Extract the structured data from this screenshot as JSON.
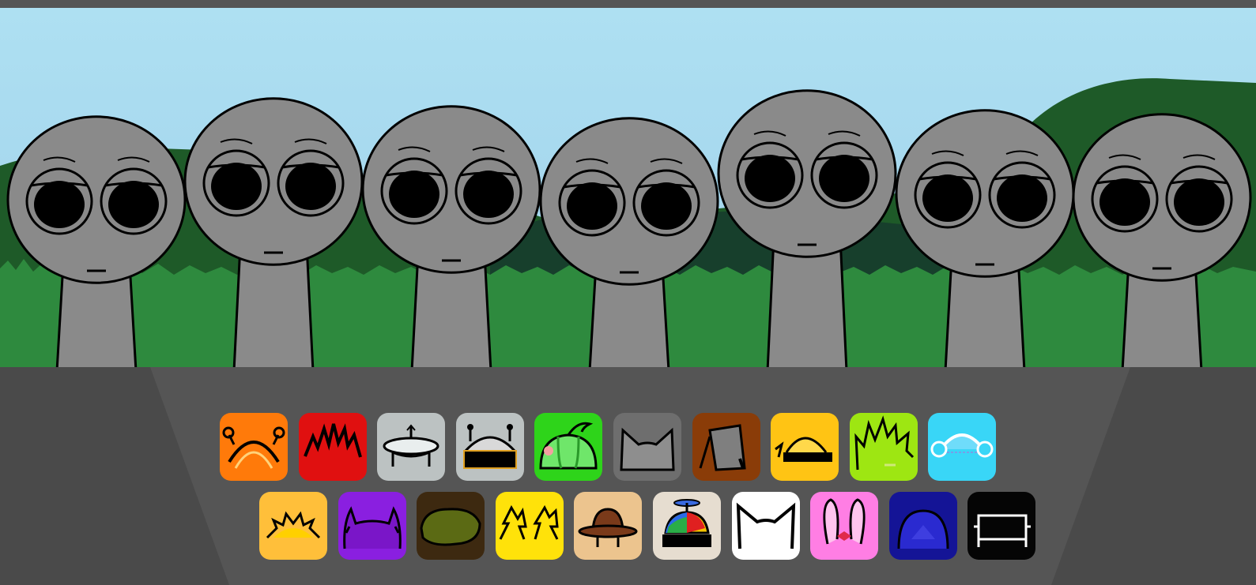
{
  "colors": {
    "sky_top": "#a8dbef",
    "sky_bottom": "#9fd2ea",
    "hill": "#1f5d2a",
    "grass": "#2e8a3e",
    "character": "#8a8a8a",
    "panel": "#4b4b4b",
    "panel_shade": "#565656"
  },
  "characters": [
    {
      "name": "character-1"
    },
    {
      "name": "character-2"
    },
    {
      "name": "character-3"
    },
    {
      "name": "character-4"
    },
    {
      "name": "character-5"
    },
    {
      "name": "character-6"
    },
    {
      "name": "character-7"
    }
  ],
  "icon_rows": [
    [
      {
        "icon": "antenna-headband-icon",
        "bg": "#ff7a0a"
      },
      {
        "icon": "spiky-red-hair-icon",
        "bg": "#e01010"
      },
      {
        "icon": "ufo-hat-icon",
        "bg": "#bcc2c2"
      },
      {
        "icon": "robot-visor-icon",
        "bg": "#bcc2c2"
      },
      {
        "icon": "melon-hat-icon",
        "bg": "#2ed41a"
      },
      {
        "icon": "cat-ears-gray-icon",
        "bg": "#6e6e6e"
      },
      {
        "icon": "bucket-hat-icon",
        "bg": "#8a3c08"
      },
      {
        "icon": "hard-hat-visor-icon",
        "bg": "#ffc414"
      },
      {
        "icon": "green-spiky-hair-icon",
        "bg": "#9ee612"
      },
      {
        "icon": "blue-headphones-icon",
        "bg": "#39d6f7"
      }
    ],
    [
      {
        "icon": "sunrise-crown-icon",
        "bg": "#ffbf3a"
      },
      {
        "icon": "purple-horns-icon",
        "bg": "#8a1fe0"
      },
      {
        "icon": "leaf-bush-icon",
        "bg": "#3d2910"
      },
      {
        "icon": "lightning-hair-icon",
        "bg": "#ffe20a"
      },
      {
        "icon": "fedora-hat-icon",
        "bg": "#ecc48e"
      },
      {
        "icon": "propeller-cap-icon",
        "bg": "#e6ddd0"
      },
      {
        "icon": "white-cat-ears-icon",
        "bg": "#ffffff"
      },
      {
        "icon": "bunny-ears-bow-icon",
        "bg": "#ff7ee4"
      },
      {
        "icon": "navy-dome-icon",
        "bg": "#141496"
      },
      {
        "icon": "black-frame-icon",
        "bg": "#050505"
      }
    ]
  ]
}
